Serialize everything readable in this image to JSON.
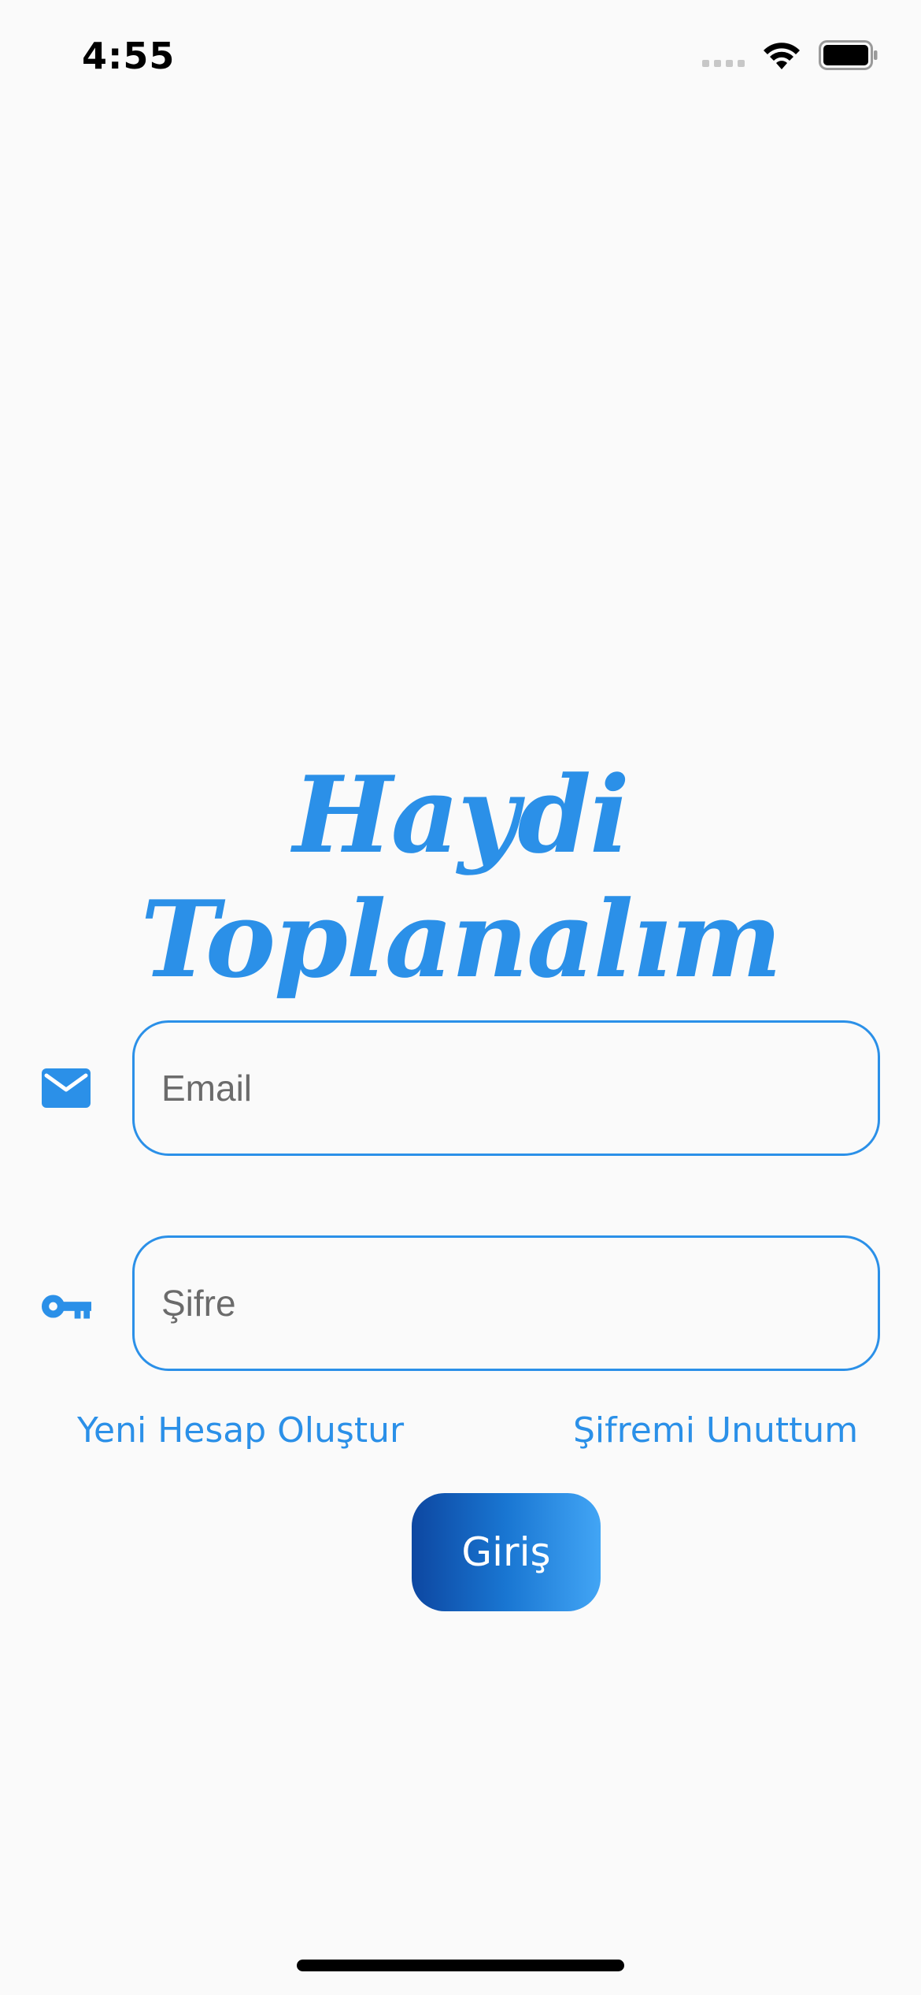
{
  "status_bar": {
    "time": "4:55",
    "icons": [
      "cellular-signal-icon",
      "wifi-icon",
      "battery-icon"
    ]
  },
  "app": {
    "title": "Haydi Toplanalım"
  },
  "form": {
    "email": {
      "icon": "mail-icon",
      "placeholder": "Email",
      "value": ""
    },
    "password": {
      "icon": "key-icon",
      "placeholder": "Şifre",
      "value": ""
    },
    "create_account_label": "Yeni Hesap Oluştur",
    "forgot_password_label": "Şifremi Unuttum",
    "login_label": "Giriş"
  },
  "colors": {
    "accent": "#2b90e8",
    "background": "#fafafa",
    "button_gradient_start": "#0d47a1",
    "button_gradient_end": "#42a5f5"
  }
}
